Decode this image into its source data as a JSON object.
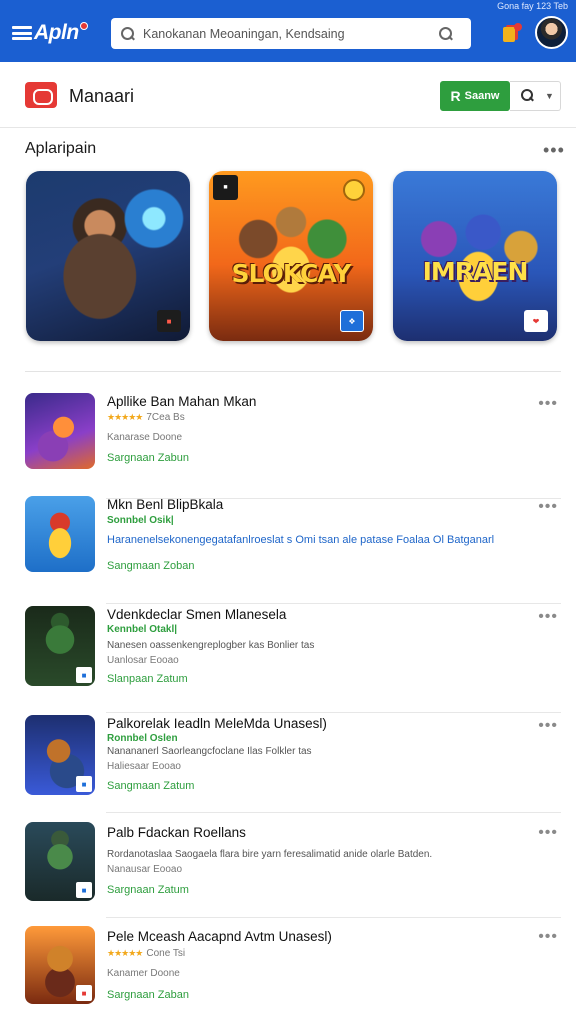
{
  "status_bar": {
    "text": "Gona fay 123 Teb"
  },
  "topbar": {
    "logo_text": "Apln",
    "search_placeholder": "Kanokanan Meoaningan, Kendsaing",
    "colors": {
      "background": "#1b5fd1",
      "accent": "#e53935"
    }
  },
  "header": {
    "title": "Manaari",
    "primary_button": "Saanw"
  },
  "featured": {
    "title": "Aplaripain",
    "cards": [
      {
        "badge": "",
        "logo": ""
      },
      {
        "badge": "",
        "logo": "SLOKCAY",
        "corner": "",
        "bottom_left": ""
      },
      {
        "badge": "",
        "logo": "IMRAEN"
      }
    ]
  },
  "apps": [
    {
      "title": "Apllike Ban Mahan Mkan",
      "rating_text": "7Cea Bs",
      "meta": "Kanarase Doone",
      "action": "Sargnaan Zabun"
    },
    {
      "title": "Mkn Benl BlipBkala",
      "rating_text": "Sonnbel Osik|",
      "description": "Haranenelsekonengegatafanlroeslat s Omi tsan ale patase Foalaa Ol Batganarl",
      "action": "Sangmaan Zoban"
    },
    {
      "title": "Vdenkdeclar Smen Mlanesela",
      "rating_text": "Kennbel Otakl|",
      "description": "Nanesen oassenkengreplogber kas Bonlier tas",
      "meta": "Uanlosar Eooao",
      "action": "Slanpaan Zatum"
    },
    {
      "title": "Palkorelak Ieadln MeleMda Unasesl)",
      "rating_text": "Ronnbel Oslen",
      "description": "Nanananerl Saorleangcfoclane Ilas Folkler tas",
      "meta": "Haliesaar Eooao",
      "action": "Sangmaan Zatum"
    },
    {
      "title": "Palb Fdackan Roellans",
      "description": "Rordanotaslaa Saogaela flara bire yarn feresalimatid anide olarle Batden.",
      "meta": "Nanausar Eooao",
      "action": "Sargnaan Zatum"
    },
    {
      "title": "Pele Mceash Aacapnd Avtm Unasesl)",
      "rating_text": "Cone Tsi",
      "meta": "Kanamer Doone",
      "action": "Sargnaan Zaban"
    }
  ]
}
